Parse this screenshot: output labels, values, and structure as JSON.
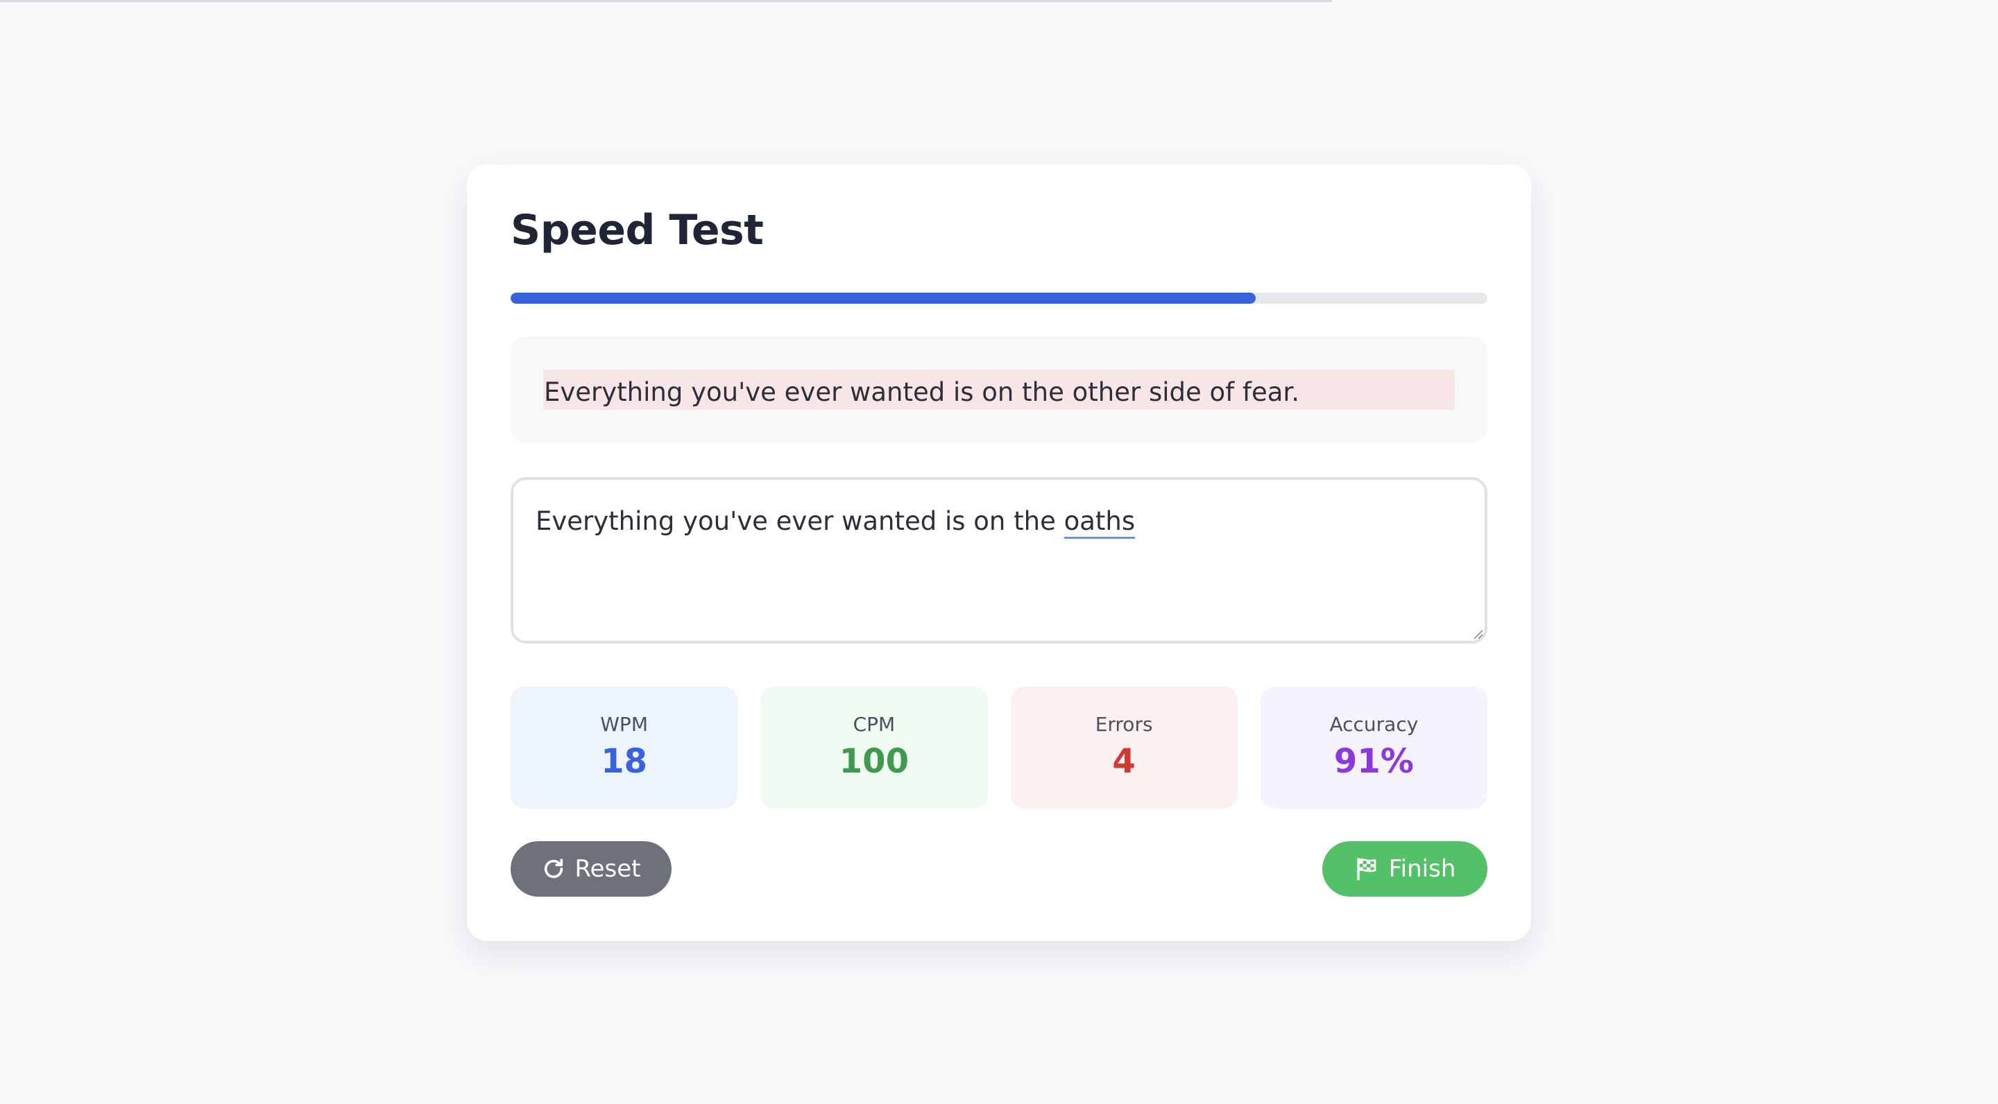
{
  "title": "Speed Test",
  "progress": {
    "fraction": 0.763,
    "color": "#3762dc"
  },
  "prompt": {
    "text": "Everything you've ever wanted is on the other side of fear."
  },
  "input": {
    "typed_prefix": "Everything you've ever wanted is on the ",
    "typed_last_word": "oaths"
  },
  "stats": [
    {
      "label": "WPM",
      "value": "18",
      "color": "#3762dc",
      "bg": "#eef4fe"
    },
    {
      "label": "CPM",
      "value": "100",
      "color": "#3f9a50",
      "bg": "#effbf1"
    },
    {
      "label": "Errors",
      "value": "4",
      "color": "#d03a32",
      "bg": "#fcf0f0"
    },
    {
      "label": "Accuracy",
      "value": "91%",
      "color": "#8a3ad8",
      "bg": "#f6f3fe"
    }
  ],
  "buttons": {
    "reset": {
      "label": "Reset",
      "icon": "rotate-cw-icon"
    },
    "finish": {
      "label": "Finish",
      "icon": "checkered-flag-icon"
    }
  }
}
